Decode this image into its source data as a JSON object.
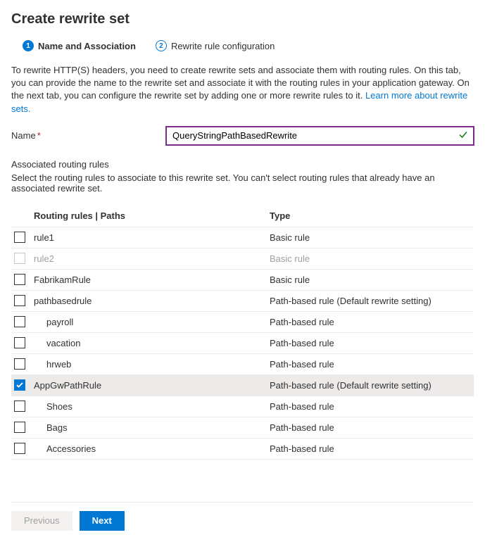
{
  "title": "Create rewrite set",
  "tabs": [
    {
      "num": "1",
      "label": "Name and Association",
      "active": true
    },
    {
      "num": "2",
      "label": "Rewrite rule configuration",
      "active": false
    }
  ],
  "description_text": "To rewrite HTTP(S) headers, you need to create rewrite sets and associate them with routing rules. On this tab, you can provide the name to the rewrite set and associate it with the routing rules in your application gateway. On the next tab, you can configure the rewrite set by adding one or more rewrite rules to it.",
  "learn_more": "Learn more about rewrite sets.",
  "name_label": "Name",
  "name_value": "QueryStringPathBasedRewrite",
  "assoc_label": "Associated routing rules",
  "assoc_sub": "Select the routing rules to associate to this rewrite set. You can't select routing rules that already have an associated rewrite set.",
  "columns": {
    "name": "Routing rules | Paths",
    "type": "Type"
  },
  "rows": [
    {
      "name": "rule1",
      "type": "Basic rule",
      "checked": false,
      "disabled": false,
      "indent": false
    },
    {
      "name": "rule2",
      "type": "Basic rule",
      "checked": false,
      "disabled": true,
      "indent": false
    },
    {
      "name": "FabrikamRule",
      "type": "Basic rule",
      "checked": false,
      "disabled": false,
      "indent": false
    },
    {
      "name": "pathbasedrule",
      "type": "Path-based rule (Default rewrite setting)",
      "checked": false,
      "disabled": false,
      "indent": false
    },
    {
      "name": "payroll",
      "type": "Path-based rule",
      "checked": false,
      "disabled": false,
      "indent": true
    },
    {
      "name": "vacation",
      "type": "Path-based rule",
      "checked": false,
      "disabled": false,
      "indent": true
    },
    {
      "name": "hrweb",
      "type": "Path-based rule",
      "checked": false,
      "disabled": false,
      "indent": true
    },
    {
      "name": "AppGwPathRule",
      "type": "Path-based rule (Default rewrite setting)",
      "checked": true,
      "disabled": false,
      "indent": false
    },
    {
      "name": "Shoes",
      "type": "Path-based rule",
      "checked": false,
      "disabled": false,
      "indent": true
    },
    {
      "name": "Bags",
      "type": "Path-based rule",
      "checked": false,
      "disabled": false,
      "indent": true
    },
    {
      "name": "Accessories",
      "type": "Path-based rule",
      "checked": false,
      "disabled": false,
      "indent": true
    }
  ],
  "buttons": {
    "previous": "Previous",
    "next": "Next"
  }
}
